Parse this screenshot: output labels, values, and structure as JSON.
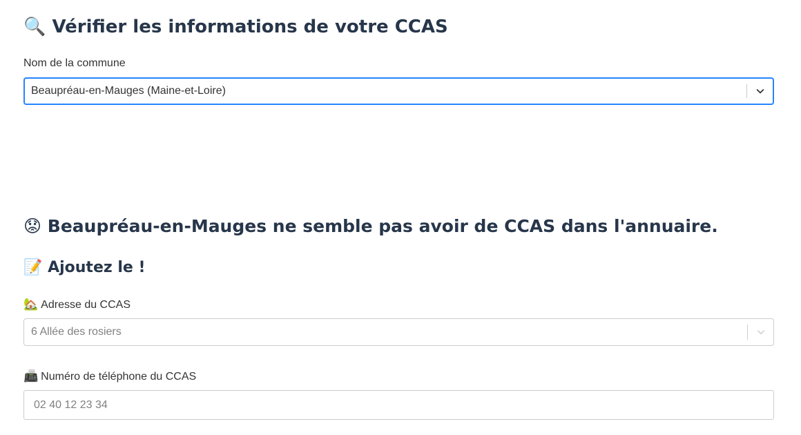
{
  "check_section": {
    "icon": "magnifying-glass-icon",
    "icon_glyph": "🔍",
    "title": "Vérifier les informations de votre CCAS",
    "commune_label": "Nom de la commune",
    "commune_value": "Beaupréau-en-Mauges (Maine-et-Loire)"
  },
  "result": {
    "icon": "worried-face-icon",
    "icon_glyph": "😟",
    "message": "Beaupréau-en-Mauges ne semble pas avoir de CCAS dans l'annuaire."
  },
  "add_section": {
    "icon": "memo-icon",
    "icon_glyph": "📝",
    "title": "Ajoutez le !",
    "address_icon": "house-with-garden-icon",
    "address_icon_glyph": "🏡",
    "address_label": "Adresse du CCAS",
    "address_placeholder": "6 Allée des rosiers",
    "phone_icon": "fax-machine-icon",
    "phone_icon_glyph": "📠",
    "phone_label": "Numéro de téléphone du CCAS",
    "phone_placeholder": "02 40 12 23 34"
  },
  "colors": {
    "heading": "#27364a",
    "focus_border": "#2684ff",
    "border": "#cccccc",
    "placeholder": "#808080"
  }
}
